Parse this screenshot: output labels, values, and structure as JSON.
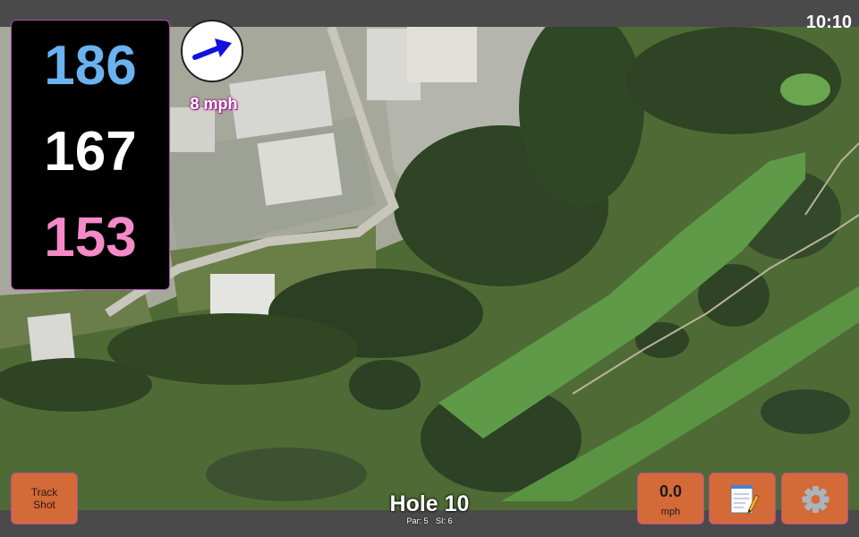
{
  "status": {
    "time": "10:10"
  },
  "distances": {
    "back": "186",
    "middle": "167",
    "front": "153"
  },
  "wind": {
    "speed_label": "8 mph",
    "direction_icon": "arrow-right-icon"
  },
  "hole": {
    "title": "Hole 10",
    "par_label": "Par: 5",
    "si_label": "SI: 6"
  },
  "buttons": {
    "track_shot_line1": "Track",
    "track_shot_line2": "Shot",
    "wind_value": "0.0",
    "wind_unit": "mph",
    "notes_icon": "notepad-icon",
    "settings_icon": "gear-icon"
  },
  "colors": {
    "back": "#6ab2f0",
    "middle": "#ffffff",
    "front": "#f58ac8",
    "button": "#d46a38",
    "panel_border": "#b04ab0"
  }
}
